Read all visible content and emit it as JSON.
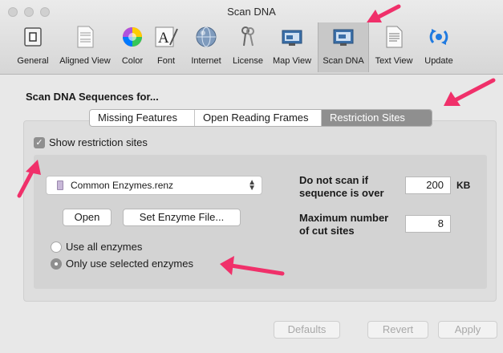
{
  "window": {
    "title": "Scan DNA"
  },
  "toolbar": {
    "items": [
      {
        "label": "General",
        "icon": "general-prefs-icon"
      },
      {
        "label": "Aligned View",
        "icon": "aligned-view-icon"
      },
      {
        "label": "Color",
        "icon": "color-wheel-icon"
      },
      {
        "label": "Font",
        "icon": "font-icon"
      },
      {
        "label": "Internet",
        "icon": "globe-icon"
      },
      {
        "label": "License",
        "icon": "keys-icon"
      },
      {
        "label": "Map View",
        "icon": "map-view-icon"
      },
      {
        "label": "Scan DNA",
        "icon": "scan-dna-icon",
        "selected": true
      },
      {
        "label": "Text View",
        "icon": "text-view-icon"
      },
      {
        "label": "Update",
        "icon": "update-icon"
      }
    ]
  },
  "main": {
    "heading": "Scan DNA Sequences for...",
    "tabs": [
      {
        "label": "Missing Features",
        "selected": false
      },
      {
        "label": "Open Reading Frames",
        "selected": false
      },
      {
        "label": "Restriction Sites",
        "selected": true
      }
    ],
    "show_restriction_sites": {
      "label": "Show restriction sites",
      "checked": true
    },
    "enzyme_file": {
      "value": "Common Enzymes.renz"
    },
    "open_button": "Open",
    "set_enzyme_file_button": "Set Enzyme File...",
    "radio_options": [
      {
        "label": "Use all enzymes",
        "selected": false
      },
      {
        "label": "Only use selected enzymes",
        "selected": true
      }
    ],
    "do_not_scan": {
      "label_line1": "Do not scan if",
      "label_line2": "sequence is over",
      "value": "200",
      "unit": "KB"
    },
    "max_cut_sites": {
      "label_line1": "Maximum number",
      "label_line2": "of cut sites",
      "value": "8"
    }
  },
  "footer": {
    "defaults_button": "Defaults",
    "revert_button": "Revert",
    "apply_button": "Apply"
  },
  "colors": {
    "annotation_arrow": "#f0306a",
    "selected_segment": "#8f8f8f"
  }
}
